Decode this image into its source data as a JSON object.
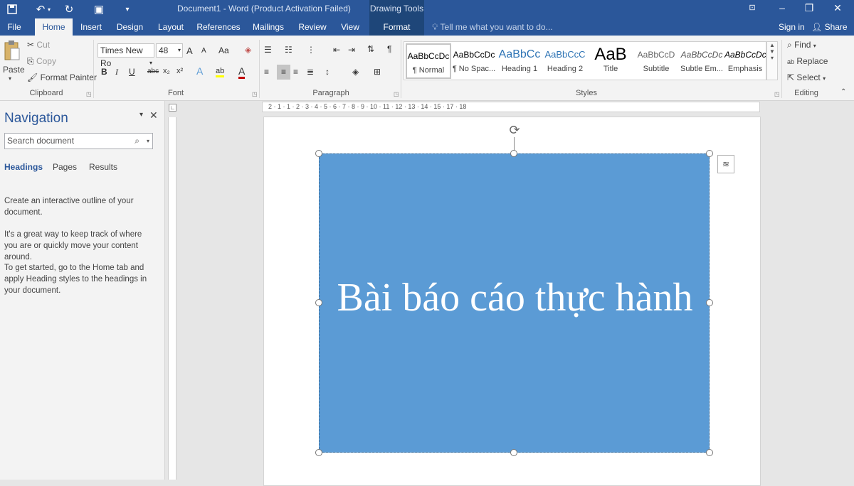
{
  "title_bar": {
    "document_title": "Document1 - Word (Product Activation Failed)",
    "context_label": "Drawing Tools",
    "quick_access": [
      "save-icon",
      "undo-icon",
      "redo-icon",
      "touch-mode-icon",
      "customize-icon"
    ]
  },
  "tabs": {
    "file": "File",
    "home": "Home",
    "insert": "Insert",
    "design": "Design",
    "layout": "Layout",
    "references": "References",
    "mailings": "Mailings",
    "review": "Review",
    "view": "View",
    "format": "Format",
    "tell_me": "Tell me what you want to do...",
    "sign_in": "Sign in",
    "share": "Share"
  },
  "ribbon": {
    "clipboard": {
      "paste": "Paste",
      "cut": "Cut",
      "copy": "Copy",
      "format_painter": "Format Painter",
      "label": "Clipboard"
    },
    "font": {
      "name": "Times New Ro",
      "size": "48",
      "grow": "A",
      "shrink": "A",
      "case": "Aa",
      "bold": "B",
      "italic": "I",
      "underline": "U",
      "strike": "abc",
      "subscript": "x₂",
      "superscript": "x²",
      "text_effects": "A",
      "highlight": "ab",
      "color": "A",
      "label": "Font"
    },
    "paragraph": {
      "label": "Paragraph",
      "pilcrow": "¶"
    },
    "styles": {
      "label": "Styles",
      "items": [
        {
          "sample": "AaBbCcDc",
          "name": "¶ Normal"
        },
        {
          "sample": "AaBbCcDc",
          "name": "¶ No Spac..."
        },
        {
          "sample": "AaBbCc",
          "name": "Heading 1"
        },
        {
          "sample": "AaBbCcC",
          "name": "Heading 2"
        },
        {
          "sample": "AaB",
          "name": "Title"
        },
        {
          "sample": "AaBbCcD",
          "name": "Subtitle"
        },
        {
          "sample": "AaBbCcDc",
          "name": "Subtle Em..."
        },
        {
          "sample": "AaBbCcDc",
          "name": "Emphasis"
        }
      ]
    },
    "editing": {
      "find": "Find",
      "replace": "Replace",
      "select": "Select",
      "label": "Editing"
    }
  },
  "navigation": {
    "title": "Navigation",
    "search_placeholder": "Search document",
    "tabs": [
      "Headings",
      "Pages",
      "Results"
    ],
    "help_1": "Create an interactive outline of your document.",
    "help_2": "It's a great way to keep track of where you are or quickly move your content around.",
    "help_3": "To get started, go to the Home tab and apply Heading styles to the headings in your document."
  },
  "ruler": {
    "h_numbers": "2 · 1 · 1 · 2 · 3 · 4 · 5 · 6 · 7 · 8 · 9 · 10 · 11 · 12 · 13 · 14 · 15 · 17 · 18"
  },
  "document": {
    "shape_text": "Bài báo cáo thực hành",
    "shape_fill": "#5b9bd5"
  },
  "colors": {
    "brand": "#2b579a",
    "context_tab": "#1e4679",
    "ribbon_bg": "#f3f3f3"
  }
}
